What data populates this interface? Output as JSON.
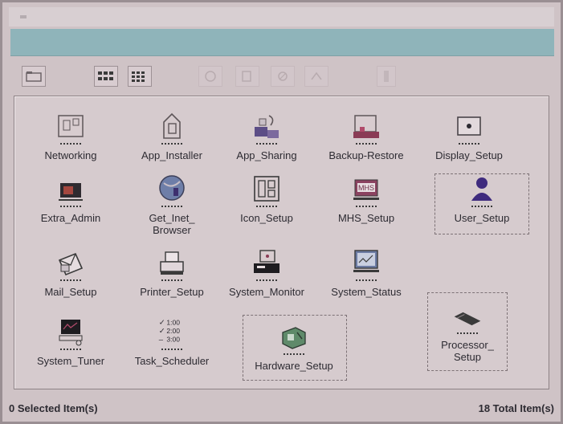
{
  "window": {
    "title": "",
    "menu": [
      "",
      "",
      "",
      ""
    ]
  },
  "toolbar": {
    "buttons": [
      "open-folder-icon",
      "large-icons-view-icon",
      "small-icons-view-icon",
      "cut-icon",
      "copy-icon",
      "paste-icon",
      "up-icon",
      "properties-icon"
    ]
  },
  "items": [
    {
      "label": "Networking",
      "icon": "networking-icon"
    },
    {
      "label": "App_Installer",
      "icon": "installer-icon"
    },
    {
      "label": "App_Sharing",
      "icon": "sharing-icon"
    },
    {
      "label": "Backup-Restore",
      "icon": "backup-icon"
    },
    {
      "label": "Display_Setup",
      "icon": "display-icon"
    },
    {
      "label": "Extra_Admin",
      "icon": "admin-icon"
    },
    {
      "label": "Get_Inet_\nBrowser",
      "icon": "globe-icon"
    },
    {
      "label": "Icon_Setup",
      "icon": "icon-setup-icon"
    },
    {
      "label": "MHS_Setup",
      "icon": "mhs-icon"
    },
    {
      "label": "User_Setup",
      "icon": "user-icon"
    },
    {
      "label": "Mail_Setup",
      "icon": "mail-icon"
    },
    {
      "label": "Printer_Setup",
      "icon": "printer-icon"
    },
    {
      "label": "System_Monitor",
      "icon": "monitor-icon"
    },
    {
      "label": "System_Status",
      "icon": "status-icon"
    },
    {
      "label": "Processor_\nSetup",
      "icon": "processor-icon"
    },
    {
      "label": "System_Tuner",
      "icon": "tuner-icon"
    },
    {
      "label": "Task_Scheduler",
      "icon": "scheduler-icon"
    },
    {
      "label": "Hardware_Setup",
      "icon": "hardware-icon"
    }
  ],
  "mhs_badge": "MHS",
  "scheduler_text": [
    "1:00",
    "2:00",
    "3:00"
  ],
  "status": {
    "selected": "0 Selected Item(s)",
    "total": "18 Total Item(s)"
  }
}
